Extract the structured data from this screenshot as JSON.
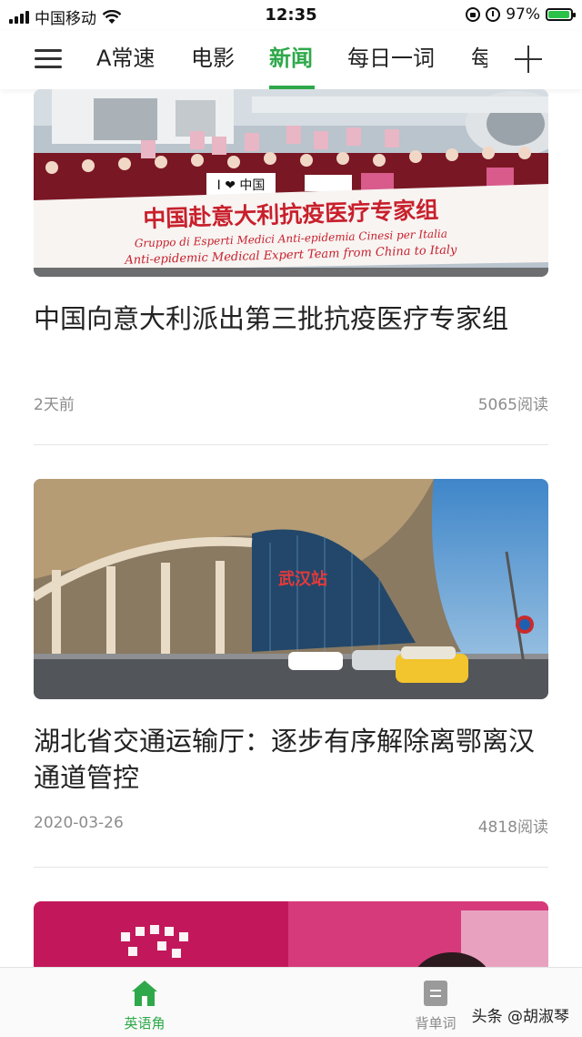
{
  "status_bar": {
    "carrier": "中国移动",
    "time": "12:35",
    "battery": "97%",
    "battery_level": 0.97,
    "wifi_icon": "wifi-icon",
    "lock_icon": "orientation-lock-icon",
    "alarm_icon": "alarm-icon"
  },
  "nav": {
    "tabs": [
      {
        "label": "A常速"
      },
      {
        "label": "电影"
      },
      {
        "label": "新闻"
      },
      {
        "label": "每日一词"
      },
      {
        "label": "每"
      }
    ],
    "active_tab": "新闻",
    "accent_color": "#2ea84a"
  },
  "articles": [
    {
      "title": "中国向意大利派出第三批抗疫医疗专家组",
      "banner_cn": "中国赴意大利抗疫医疗专家组",
      "banner_it": "Gruppo di Esperti Medici Anti-epidemia Cinesi per Italia",
      "banner_en": "Anti-epidemic Medical Expert Team from China to Italy",
      "sign_cn": "I ❤ 中国",
      "time": "2天前",
      "reads": "5065阅读"
    },
    {
      "title": "湖北省交通运输厅：逐步有序解除离鄂离汉通道管控",
      "station_sign": "武汉站",
      "time": "2020-03-26",
      "reads": "4818阅读"
    }
  ],
  "bottom_bar": {
    "items": [
      {
        "label": "英语角",
        "icon": "home-icon",
        "active": true
      },
      {
        "label": "背单词",
        "icon": "flashcard-icon",
        "active": false
      }
    ],
    "watermark": "头条 @胡淑琴"
  }
}
